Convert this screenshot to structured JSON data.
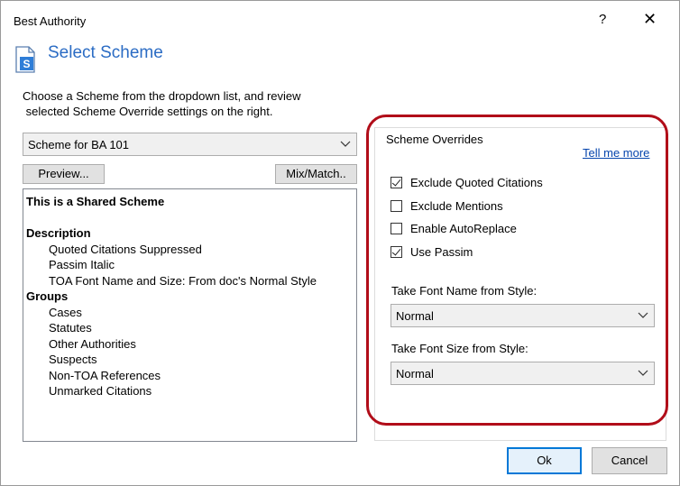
{
  "window": {
    "title": "Best Authority",
    "help_glyph": "?",
    "close_glyph": "✕"
  },
  "header": {
    "icon": "document-s-icon",
    "title": "Select Scheme"
  },
  "instructions": {
    "line1": "Choose a Scheme from the dropdown list, and review",
    "line2": " selected Scheme Override settings on the right."
  },
  "scheme_select": {
    "value": "Scheme for BA 101"
  },
  "buttons": {
    "preview": "Preview...",
    "mixmatch": "Mix/Match..",
    "ok": "Ok",
    "cancel": "Cancel"
  },
  "description": {
    "shared": "This is a Shared Scheme",
    "desc_heading": "Description",
    "desc_items": [
      "Quoted Citations Suppressed",
      "Passim Italic",
      "TOA Font Name and Size: From doc's Normal Style"
    ],
    "groups_heading": "Groups",
    "groups": [
      "Cases",
      "Statutes",
      "Other Authorities",
      "Suspects",
      "Non-TOA References",
      "Unmarked Citations"
    ]
  },
  "overrides": {
    "legend": "Scheme Overrides",
    "tell_more": "Tell me more",
    "checkboxes": [
      {
        "label": "Exclude Quoted Citations",
        "checked": true
      },
      {
        "label": "Exclude Mentions",
        "checked": false
      },
      {
        "label": "Enable AutoReplace",
        "checked": false
      },
      {
        "label": "Use Passim",
        "checked": true
      }
    ],
    "font_name_label": "Take Font Name from Style:",
    "font_name_value": "Normal",
    "font_size_label": "Take Font Size from Style:",
    "font_size_value": "Normal"
  },
  "colors": {
    "accent_title": "#2b6cc4",
    "highlight_outline": "#b10d19",
    "link": "#0645ad"
  }
}
